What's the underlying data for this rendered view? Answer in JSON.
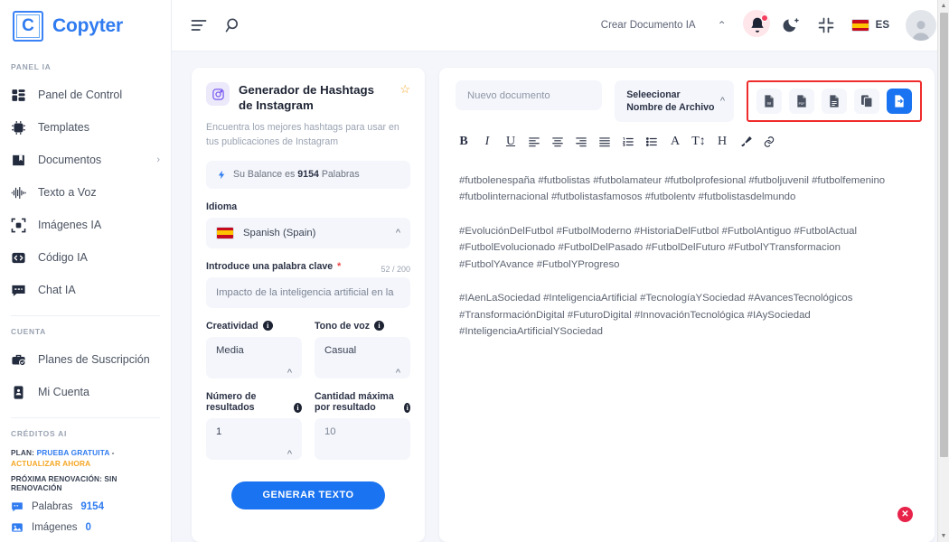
{
  "brand": {
    "mark": "C",
    "name": "Copyter"
  },
  "sidebar": {
    "section_panel": "PANEL IA",
    "items": [
      {
        "label": "Panel de Control",
        "icon": "dashboard-icon"
      },
      {
        "label": "Templates",
        "icon": "ai-chip-icon"
      },
      {
        "label": "Documentos",
        "icon": "folder-icon",
        "chevron": "›"
      },
      {
        "label": "Texto a Voz",
        "icon": "waveform-icon"
      },
      {
        "label": "Imágenes IA",
        "icon": "camera-scan-icon"
      },
      {
        "label": "Código IA",
        "icon": "code-icon"
      },
      {
        "label": "Chat IA",
        "icon": "chat-icon"
      }
    ],
    "section_account": "CUENTA",
    "account_items": [
      {
        "label": "Planes de Suscripción",
        "icon": "briefcase-check-icon"
      },
      {
        "label": "Mi Cuenta",
        "icon": "id-card-icon"
      }
    ],
    "section_credits": "CRÉDITOS AI",
    "plan_prefix": "PLAN:",
    "plan_name": "PRUEBA GRATUITA",
    "plan_dash": "-",
    "plan_upgrade": "ACTUALIZAR AHORA",
    "renewal": "PRÓXIMA RENOVACIÓN: SIN RENOVACIÓN",
    "credits": [
      {
        "name": "Palabras",
        "value": "9154",
        "icon": "chat-bubble-icon"
      },
      {
        "name": "Imágenes",
        "value": "0",
        "icon": "image-icon"
      }
    ]
  },
  "topbar": {
    "menu_icon": "hamburger-icon",
    "search_icon": "search-icon",
    "create_doc_label": "Crear Documento IA",
    "create_doc_caret": "⌃",
    "bell_icon": "notification-bell-icon",
    "theme_icon": "dark-mode-moon-icon",
    "fullscreen_icon": "exit-fullscreen-icon",
    "lang_code": "ES",
    "avatar": "user-avatar"
  },
  "form": {
    "app_icon": "instagram-icon",
    "title": "Generador de Hashtags de Instagram",
    "favorite_star": "☆",
    "description": "Encuentra los mejores hashtags para usar en tus publicaciones de Instagram",
    "balance_prefix": "Su Balance es",
    "balance_value": "9154",
    "balance_suffix": "Palabras",
    "language_label": "Idioma",
    "language_value": "Spanish (Spain)",
    "keyword_label": "Introduce una palabra clave",
    "keyword_required": "*",
    "keyword_counter": "52 / 200",
    "keyword_value": "Impacto de la inteligencia artificial en la",
    "creativity_label": "Creatividad",
    "creativity_value": "Media",
    "tone_label": "Tono de voz",
    "tone_value": "Casual",
    "results_label": "Número de resultados",
    "results_value": "1",
    "max_label": "Cantidad máxima por resultado",
    "max_value": "10",
    "generate_button": "GENERAR TEXTO"
  },
  "editor": {
    "doc_name_placeholder": "Nuevo documento",
    "file_select_label": "Seleecionar Nombre de Archivo",
    "export_buttons": [
      {
        "name": "export-word-button",
        "icon": "word-doc-icon",
        "label": "W"
      },
      {
        "name": "export-pdf-button",
        "icon": "pdf-doc-icon",
        "label": "PDF"
      },
      {
        "name": "export-text-button",
        "icon": "text-doc-icon",
        "label": ""
      },
      {
        "name": "copy-button",
        "icon": "copy-icon",
        "label": ""
      },
      {
        "name": "save-document-button",
        "icon": "save-export-icon",
        "label": ""
      }
    ],
    "toolbar": [
      {
        "name": "bold-button",
        "glyph": "B"
      },
      {
        "name": "italic-button",
        "glyph": "I"
      },
      {
        "name": "underline-button",
        "glyph": "U"
      },
      {
        "name": "align-left-button",
        "glyph": "align-left-icon"
      },
      {
        "name": "align-center-button",
        "glyph": "align-center-icon"
      },
      {
        "name": "align-right-button",
        "glyph": "align-right-icon"
      },
      {
        "name": "align-justify-button",
        "glyph": "align-justify-icon"
      },
      {
        "name": "ordered-list-button",
        "glyph": "ordered-list-icon"
      },
      {
        "name": "bullet-list-button",
        "glyph": "bullet-list-icon"
      },
      {
        "name": "font-color-button",
        "glyph": "A"
      },
      {
        "name": "font-size-button",
        "glyph": "T↕"
      },
      {
        "name": "heading-button",
        "glyph": "H"
      },
      {
        "name": "highlight-button",
        "glyph": "brush-icon"
      },
      {
        "name": "link-button",
        "glyph": "link-icon"
      }
    ],
    "paragraphs": [
      "#futbolenespaña #futbolistas #futbolamateur #futbolprofesional #futboljuvenil #futbolfemenino #futbolinternacional #futbolistasfamosos #futbolentv #futbolistasdelmundo",
      "#EvoluciónDelFutbol #FutbolModerno #HistoriaDelFutbol #FutbolAntiguo #FutbolActual #FutbolEvolucionado #FutbolDelPasado #FutbolDelFuturo #FutbolYTransformacion #FutbolYAvance #FutbolYProgreso",
      "#IAenLaSociedad #InteligenciaArtificial #TecnologíaYSociedad #AvancesTecnológicos #TransformaciónDigital #FuturoDigital #InnovaciónTecnológica #IAySociedad #InteligenciaArtificialYSociedad"
    ],
    "close_badge": "✕"
  },
  "colors": {
    "brand_blue": "#2f7bf0",
    "accent_blue": "#1a73f0",
    "highlight_red": "#ef2b2b",
    "upgrade_orange": "#f5a623",
    "close_red": "#e8234a"
  }
}
